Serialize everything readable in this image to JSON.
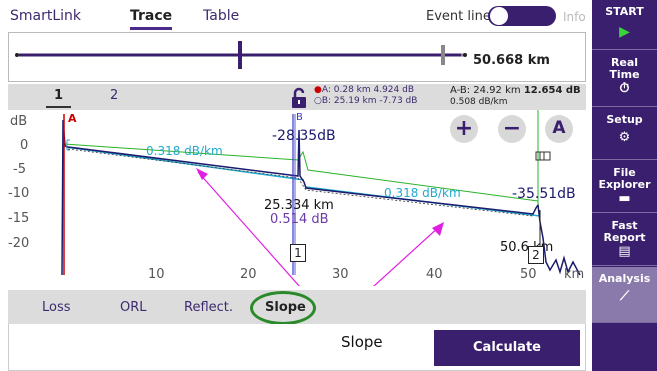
{
  "tabs": {
    "smartlink": "SmartLink",
    "trace": "Trace",
    "table": "Table"
  },
  "event_line": {
    "label": "Event line",
    "info": "Info"
  },
  "overview": {
    "distance": "50.668 km"
  },
  "trace_header": {
    "trace1": "1",
    "trace2": "2",
    "marker_a": "A: 0.28 km 4.924 dB",
    "marker_b": "B: 25.19 km -7.73 dB",
    "ab_label": "A-B: 24.92 km",
    "ab_value": "12.654 dB",
    "ab_slope": "0.508 dB/km"
  },
  "graph": {
    "y_unit": "dB",
    "y_ticks": [
      "0",
      "-5",
      "-10",
      "-15",
      "-20"
    ],
    "x_ticks": [
      "10",
      "20",
      "30",
      "40",
      "50"
    ],
    "x_unit": "km",
    "marker_a": "A",
    "marker_b": "B",
    "slope1": "0.318 dB/km",
    "slope2": "0.318 dB/km",
    "event_loss": "-28.35dB",
    "end_loss": "-35.51dB",
    "event_dist": "25.334 km",
    "event_db": "0.514 dB",
    "end_dist": "50.6",
    "end_dist_unit": "km",
    "box1": "1",
    "box2": "2",
    "zoom_in": "+",
    "zoom_out": "−",
    "auto": "A"
  },
  "bottom_tabs": {
    "loss": "Loss",
    "orl": "ORL",
    "reflect": "Reflect.",
    "slope": "Slope"
  },
  "calculate": "Calculate",
  "callout": "Slope",
  "sidebar": {
    "start": "START",
    "realtime1": "Real",
    "realtime2": "Time",
    "setup": "Setup",
    "file1": "File",
    "file2": "Explorer",
    "fast1": "Fast",
    "fast2": "Report",
    "analysis": "Analysis"
  },
  "colors": {
    "accent": "#3a1f6e",
    "trace": "#1a1a6e",
    "slope_line": "#22aacc",
    "ref_line": "#2ab32a",
    "marker_a": "#cc0000",
    "annotation": "#e020e0"
  }
}
